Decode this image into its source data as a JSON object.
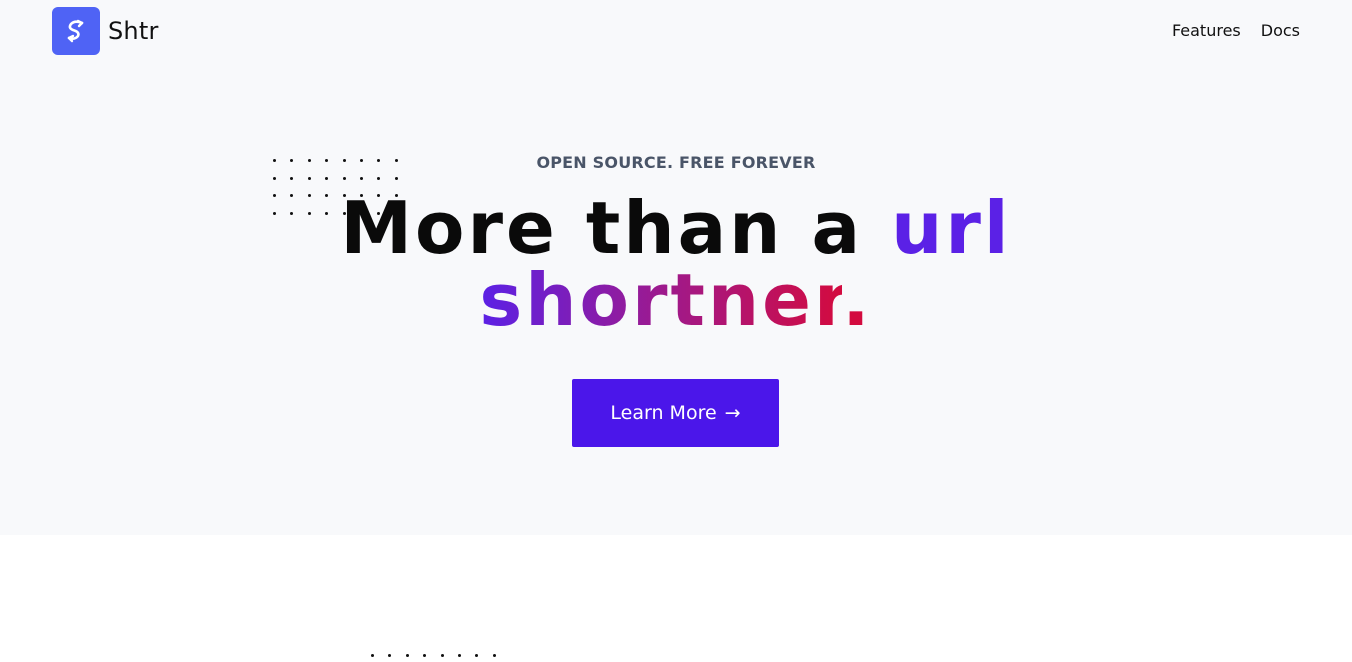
{
  "brand": {
    "name": "Shtr",
    "logo_icon": "shtr-logo-icon",
    "logo_color": "#4f63f5"
  },
  "nav": {
    "items": [
      {
        "label": "Features"
      },
      {
        "label": "Docs"
      }
    ]
  },
  "hero": {
    "eyebrow": "OPEN SOURCE. FREE FOREVER",
    "headline": {
      "part1": "More than a ",
      "accent1": "url",
      "accent2": "shortner",
      "accent_dot": "."
    },
    "cta": {
      "label": "Learn More",
      "icon": "arrow-right-icon",
      "arrow": "→"
    }
  },
  "colors": {
    "hero_bg": "#f8f9fb",
    "accent_purple": "#5b21e6",
    "accent_magenta": "#9d1a8e",
    "accent_red": "#d30b3f",
    "cta_bg": "#4b16ea"
  }
}
